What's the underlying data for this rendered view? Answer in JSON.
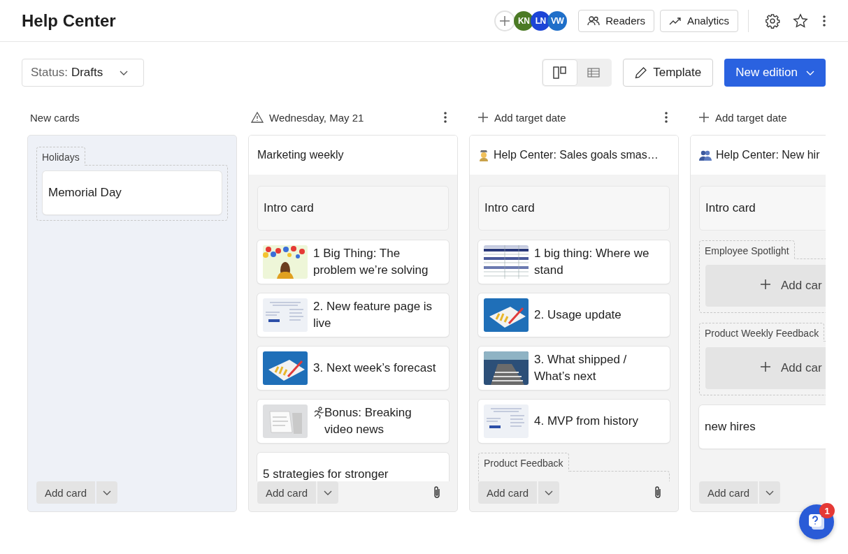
{
  "header": {
    "title": "Help Center",
    "avatars": [
      {
        "initials": "KN",
        "color": "#4b7a25"
      },
      {
        "initials": "LN",
        "color": "#1c45d6"
      },
      {
        "initials": "VW",
        "color": "#1f6fc9"
      }
    ],
    "buttons": [
      {
        "kind": "readers",
        "label": "Readers"
      },
      {
        "kind": "analytics",
        "label": "Analytics"
      }
    ]
  },
  "toolbar": {
    "status_filter": {
      "label": "Status:",
      "value": "Drafts"
    },
    "views": [
      {
        "kind": "board",
        "selected": true
      },
      {
        "kind": "table",
        "selected": false
      }
    ],
    "template_button": "Template",
    "primary_button": "New edition"
  },
  "columns": [
    {
      "kind": "inbox",
      "header": {
        "kind": "label",
        "text": "New cards",
        "menu": false
      },
      "items": [
        {
          "kind": "group",
          "label": "Holidays",
          "children": [
            {
              "kind": "card",
              "text": "Memorial Day"
            }
          ]
        }
      ],
      "footer": {
        "add_label": "Add card",
        "attachment": false
      }
    },
    {
      "kind": "edition",
      "header": {
        "kind": "warning",
        "text": "Wednesday, May 21",
        "menu": true
      },
      "title": "Marketing weekly",
      "items": [
        {
          "kind": "intro",
          "text": "Intro card"
        },
        {
          "kind": "story",
          "text": "1 Big Thing: The problem we’re solving"
        },
        {
          "kind": "story",
          "text": "2. New feature page is live"
        },
        {
          "kind": "story",
          "text": "3. Next week’s forecast"
        },
        {
          "kind": "story",
          "text": "Bonus: Breaking video news"
        },
        {
          "kind": "card",
          "text": "5 strategies for stronger"
        }
      ],
      "footer": {
        "add_label": "Add card",
        "attachment": true
      }
    },
    {
      "kind": "edition",
      "header": {
        "kind": "add",
        "text": "Add target date",
        "menu": true
      },
      "title": "Help Center: Sales goals smas…",
      "items": [
        {
          "kind": "intro",
          "text": "Intro card"
        },
        {
          "kind": "story",
          "text": "1 big thing: Where we stand"
        },
        {
          "kind": "story",
          "text": "2. Usage update"
        },
        {
          "kind": "story",
          "text": "3. What shipped / What’s next"
        },
        {
          "kind": "story",
          "text": "4. MVP from history"
        },
        {
          "kind": "group",
          "label": "Product Feedback"
        }
      ],
      "footer": {
        "add_label": "Add card",
        "attachment": true
      }
    },
    {
      "kind": "edition",
      "header": {
        "kind": "add",
        "text": "Add target date",
        "menu": false
      },
      "title": "Help Center: New hir",
      "items": [
        {
          "kind": "intro",
          "text": "Intro card"
        },
        {
          "kind": "group",
          "label": "Employee Spotlight",
          "children": [
            {
              "kind": "add",
              "text": "Add car"
            }
          ]
        },
        {
          "kind": "group",
          "label": "Product Weekly Feedback",
          "children": [
            {
              "kind": "add",
              "text": "Add car"
            }
          ]
        },
        {
          "kind": "card",
          "text": "new hires"
        }
      ],
      "footer": {
        "add_label": "Add card",
        "attachment": false
      }
    }
  ],
  "help_badge": "1"
}
